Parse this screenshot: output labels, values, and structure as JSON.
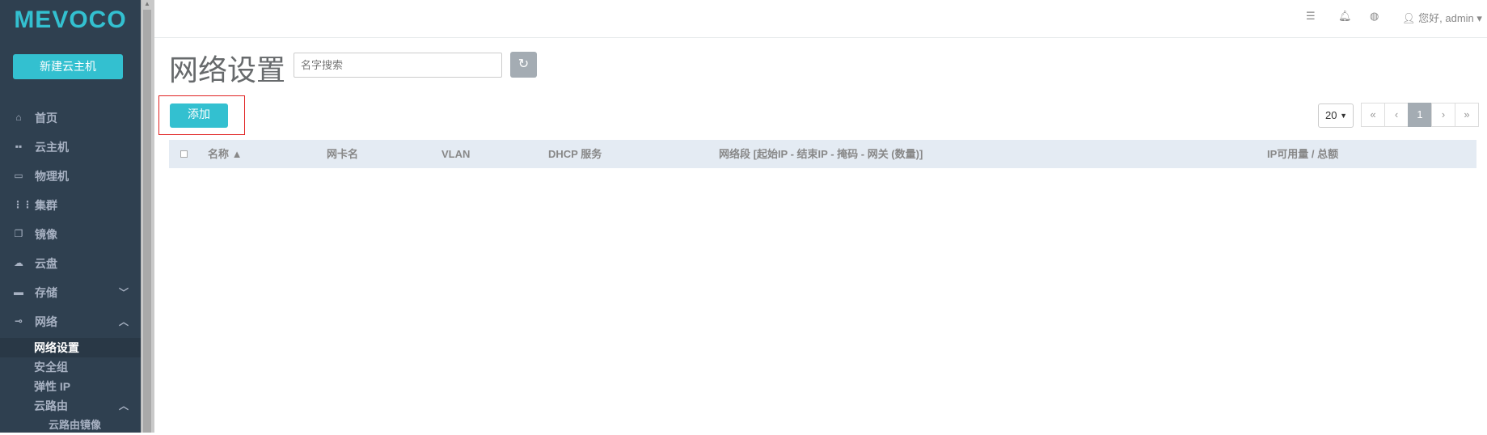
{
  "sidebar": {
    "logo": "MEVOCO",
    "new_vm_button": "新建云主机",
    "items": [
      {
        "label": "首页",
        "icon": "home-icon"
      },
      {
        "label": "云主机",
        "icon": "grid-icon"
      },
      {
        "label": "物理机",
        "icon": "monitor-icon"
      },
      {
        "label": "集群",
        "icon": "cluster-icon"
      },
      {
        "label": "镜像",
        "icon": "image-icon"
      },
      {
        "label": "云盘",
        "icon": "cloud-upload-icon"
      },
      {
        "label": "存储",
        "icon": "storage-icon",
        "expanded": false
      },
      {
        "label": "网络",
        "icon": "network-icon",
        "expanded": true
      }
    ],
    "subitems": [
      {
        "label": "网络设置",
        "active": true
      },
      {
        "label": "安全组"
      },
      {
        "label": "弹性 IP"
      },
      {
        "label": "云路由",
        "expanded": true
      },
      {
        "label": "云路由镜像"
      }
    ]
  },
  "topbar": {
    "greeting": "您好, admin"
  },
  "main": {
    "title": "网络设置",
    "search_placeholder": "名字搜索",
    "add_button": "添加",
    "page_size": "20",
    "pagination": [
      "«",
      "‹",
      "1",
      "›",
      "»"
    ],
    "current_page": "1",
    "columns": [
      "名称",
      "网卡名",
      "VLAN",
      "DHCP 服务",
      "网络段 [起始IP - 结束IP - 掩码 - 网关 (数量)]",
      "IP可用量 / 总额"
    ]
  },
  "colors": {
    "sidebar_bg": "#2f4050",
    "accent": "#33c0d0",
    "table_header_bg": "#e4ebf3",
    "highlight_border": "#e02222"
  }
}
